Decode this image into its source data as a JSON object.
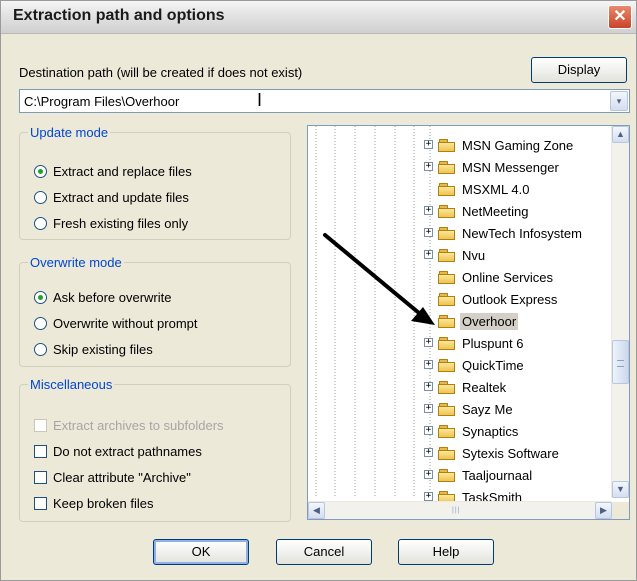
{
  "window": {
    "title": "Extraction path and options",
    "close_glyph": "✕"
  },
  "destination": {
    "label": "Destination path (will be created if does not exist)",
    "display_button": "Display",
    "path_value": "C:\\Program Files\\Overhoor",
    "dropdown_glyph": "▾",
    "cursor_glyph": "I"
  },
  "update_mode": {
    "legend": "Update mode",
    "options": [
      {
        "label": "Extract and replace files",
        "checked": true
      },
      {
        "label": "Extract and update files",
        "checked": false
      },
      {
        "label": "Fresh existing files only",
        "checked": false
      }
    ]
  },
  "overwrite_mode": {
    "legend": "Overwrite mode",
    "options": [
      {
        "label": "Ask before overwrite",
        "checked": true
      },
      {
        "label": "Overwrite without prompt",
        "checked": false
      },
      {
        "label": "Skip existing files",
        "checked": false
      }
    ]
  },
  "miscellaneous": {
    "legend": "Miscellaneous",
    "options": [
      {
        "label": "Extract archives to subfolders",
        "checked": false,
        "disabled": true
      },
      {
        "label": "Do not extract pathnames",
        "checked": false,
        "disabled": false
      },
      {
        "label": "Clear attribute \"Archive\"",
        "checked": false,
        "disabled": false
      },
      {
        "label": "Keep broken files",
        "checked": false,
        "disabled": false
      }
    ]
  },
  "folder_tree": {
    "items": [
      {
        "label": "MSN Gaming Zone",
        "expandable": true,
        "selected": false
      },
      {
        "label": "MSN Messenger",
        "expandable": true,
        "selected": false
      },
      {
        "label": "MSXML 4.0",
        "expandable": false,
        "selected": false
      },
      {
        "label": "NetMeeting",
        "expandable": true,
        "selected": false
      },
      {
        "label": "NewTech Infosystem",
        "expandable": true,
        "selected": false
      },
      {
        "label": "Nvu",
        "expandable": true,
        "selected": false
      },
      {
        "label": "Online Services",
        "expandable": false,
        "selected": false
      },
      {
        "label": "Outlook Express",
        "expandable": false,
        "selected": false
      },
      {
        "label": "Overhoor",
        "expandable": false,
        "selected": true
      },
      {
        "label": "Pluspunt 6",
        "expandable": true,
        "selected": false
      },
      {
        "label": "QuickTime",
        "expandable": true,
        "selected": false
      },
      {
        "label": "Realtek",
        "expandable": true,
        "selected": false
      },
      {
        "label": "Sayz Me",
        "expandable": true,
        "selected": false
      },
      {
        "label": "Synaptics",
        "expandable": true,
        "selected": false
      },
      {
        "label": "Sytexis Software",
        "expandable": true,
        "selected": false
      },
      {
        "label": "Taaljournaal",
        "expandable": true,
        "selected": false
      },
      {
        "label": "TaskSmith",
        "expandable": true,
        "selected": false
      }
    ],
    "scroll_up_glyph": "▲",
    "scroll_down_glyph": "▼",
    "scroll_left_glyph": "◀",
    "scroll_right_glyph": "▶",
    "grip_glyph": "|||"
  },
  "buttons": {
    "ok": "OK",
    "cancel": "Cancel",
    "help": "Help"
  },
  "colors": {
    "legend_blue": "#0046d5",
    "radio_green": "#21a121",
    "window_face": "#ece9d8"
  }
}
